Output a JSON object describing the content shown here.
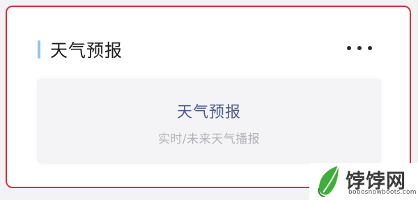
{
  "card": {
    "title": "天气预报",
    "more_icon": "more-horizontal-icon"
  },
  "panel": {
    "title": "天气预报",
    "subtitle": "实时/未来天气播报"
  },
  "watermark": {
    "brand": "饽饽网",
    "url": "bobosnowboots.com"
  },
  "colors": {
    "highlight_border": "#e02a36",
    "accent_bar": "#8ec6ef",
    "panel_title": "#4c5c88",
    "panel_subtitle": "#b3b3b9"
  }
}
